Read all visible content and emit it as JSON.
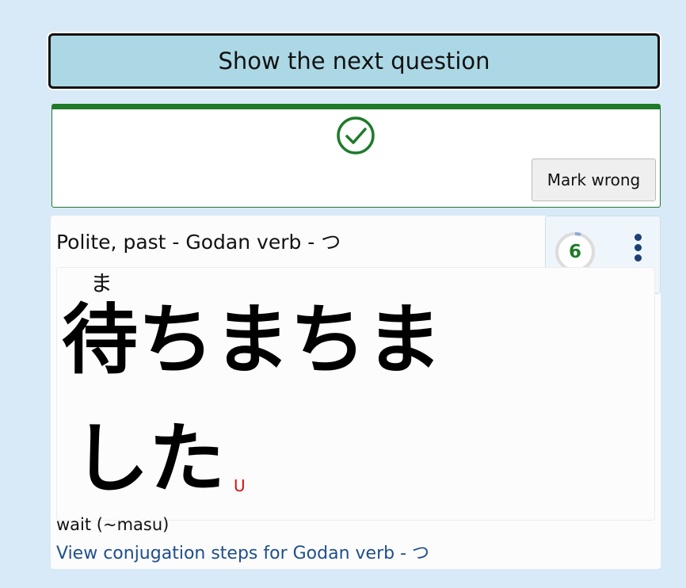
{
  "next_button": {
    "label": "Show the next question"
  },
  "result": {
    "status": "correct",
    "status_color": "#1f7a2a",
    "icon": "check-circle-icon",
    "mark_wrong_label": "Mark wrong"
  },
  "question": {
    "title": "Polite, past - Godan verb - つ",
    "furigana": "ま",
    "answer_line1": "待ちまちま",
    "answer_line2": "した",
    "annotation": "U",
    "meaning": "wait (~masu)",
    "steps_link": "View conjugation steps for Godan verb - つ"
  },
  "side_panel": {
    "progress_value": "6",
    "progress_fraction": 0.05,
    "menu_icon": "kebab-menu-icon"
  }
}
